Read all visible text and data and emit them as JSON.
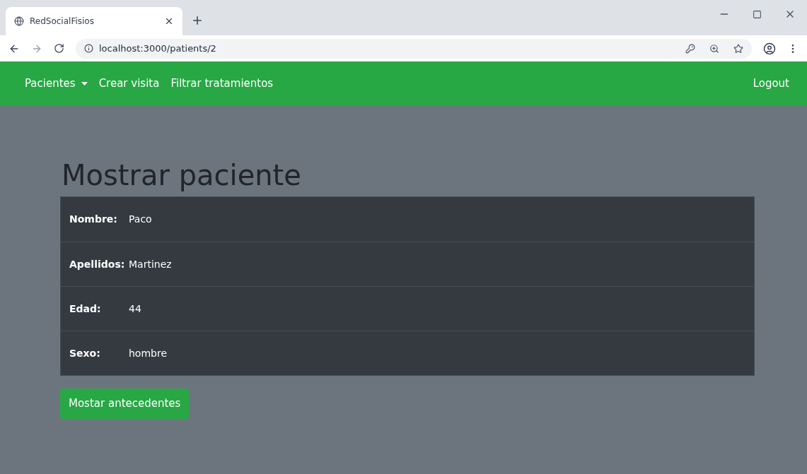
{
  "browser": {
    "tab_title": "RedSocialFisios",
    "url": "localhost:3000/patients/2"
  },
  "navbar": {
    "items": [
      {
        "label": "Pacientes",
        "dropdown": true
      },
      {
        "label": "Crear visita",
        "dropdown": false
      },
      {
        "label": "Filtrar tratamientos",
        "dropdown": false
      }
    ],
    "logout": "Logout"
  },
  "heading": "Mostrar paciente",
  "rows": [
    {
      "label": "Nombre:",
      "value": "Paco"
    },
    {
      "label": "Apellidos:",
      "value": "Martinez"
    },
    {
      "label": "Edad:",
      "value": "44"
    },
    {
      "label": "Sexo:",
      "value": "hombre"
    }
  ],
  "button": "Mostar antecedentes"
}
